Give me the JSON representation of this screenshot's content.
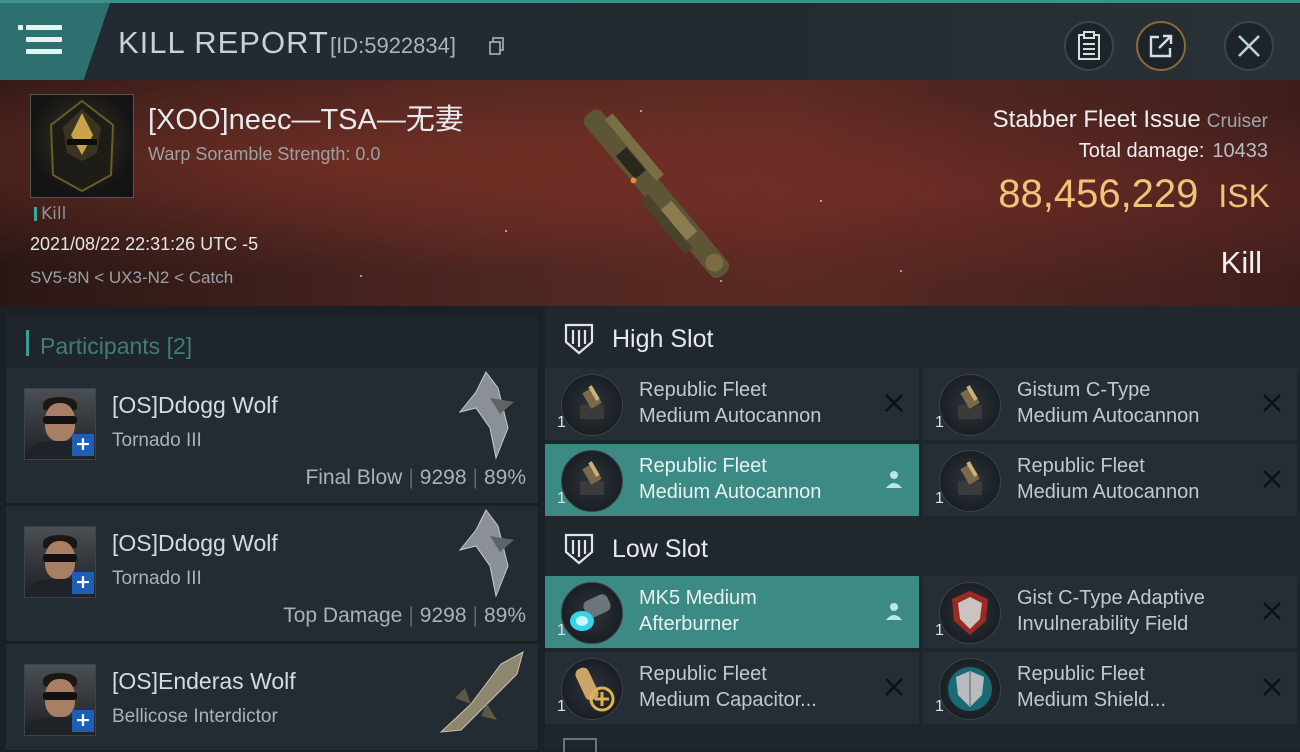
{
  "header": {
    "title": "KILL REPORT",
    "id_text": "[ID:5922834]",
    "buttons": {
      "menu": "menu-icon",
      "clipboard": "clipboard-icon",
      "share": "share-icon",
      "close": "close-icon"
    }
  },
  "victim": {
    "name": "[XOO]neec—TSA—无妻",
    "warp_scramble": "Warp Soramble Strength: 0.0",
    "kill_tag": "Kill",
    "datetime": "2021/08/22 22:31:26 UTC -5",
    "location": "SV5-8N < UX3-N2 < Catch",
    "ship": "Stabber Fleet Issue",
    "ship_class": "Cruiser",
    "total_damage_label": "Total damage:",
    "total_damage": "10433",
    "isk_value": "88,456,229",
    "isk_unit": "ISK",
    "result": "Kill"
  },
  "participants": {
    "header": "Participants",
    "count": "[2]",
    "rows": [
      {
        "name": "[OS]Ddogg Wolf",
        "ship": "Tornado III",
        "role": "Final Blow",
        "damage": "9298",
        "percent": "89%"
      },
      {
        "name": "[OS]Ddogg Wolf",
        "ship": "Tornado III",
        "role": "Top Damage",
        "damage": "9298",
        "percent": "89%"
      },
      {
        "name": "[OS]Enderas Wolf",
        "ship": "Bellicose Interdictor"
      }
    ]
  },
  "slots": {
    "high": {
      "label": "High Slot",
      "items": [
        {
          "line1": "Republic Fleet",
          "line2": "Medium Autocannon",
          "qty": "1",
          "state": "destroyed"
        },
        {
          "line1": "Gistum C-Type",
          "line2": "Medium Autocannon",
          "qty": "1",
          "state": "destroyed"
        },
        {
          "line1": "Republic Fleet",
          "line2": "Medium Autocannon",
          "qty": "1",
          "state": "dropped"
        },
        {
          "line1": "Republic Fleet",
          "line2": "Medium Autocannon",
          "qty": "1",
          "state": "destroyed"
        }
      ]
    },
    "low": {
      "label": "Low Slot",
      "items": [
        {
          "line1": "MK5 Medium",
          "line2": "Afterburner",
          "qty": "1",
          "state": "dropped"
        },
        {
          "line1": "Gist C-Type Adaptive",
          "line2": "Invulnerability Field",
          "qty": "1",
          "state": "destroyed"
        },
        {
          "line1": "Republic Fleet",
          "line2": "Medium Capacitor...",
          "qty": "1",
          "state": "destroyed"
        },
        {
          "line1": "Republic Fleet",
          "line2": "Medium Shield...",
          "qty": "1",
          "state": "destroyed"
        }
      ]
    }
  },
  "colors": {
    "accent": "#3b8a84",
    "isk": "#f0c37a",
    "badge": "#1d5fb8"
  }
}
